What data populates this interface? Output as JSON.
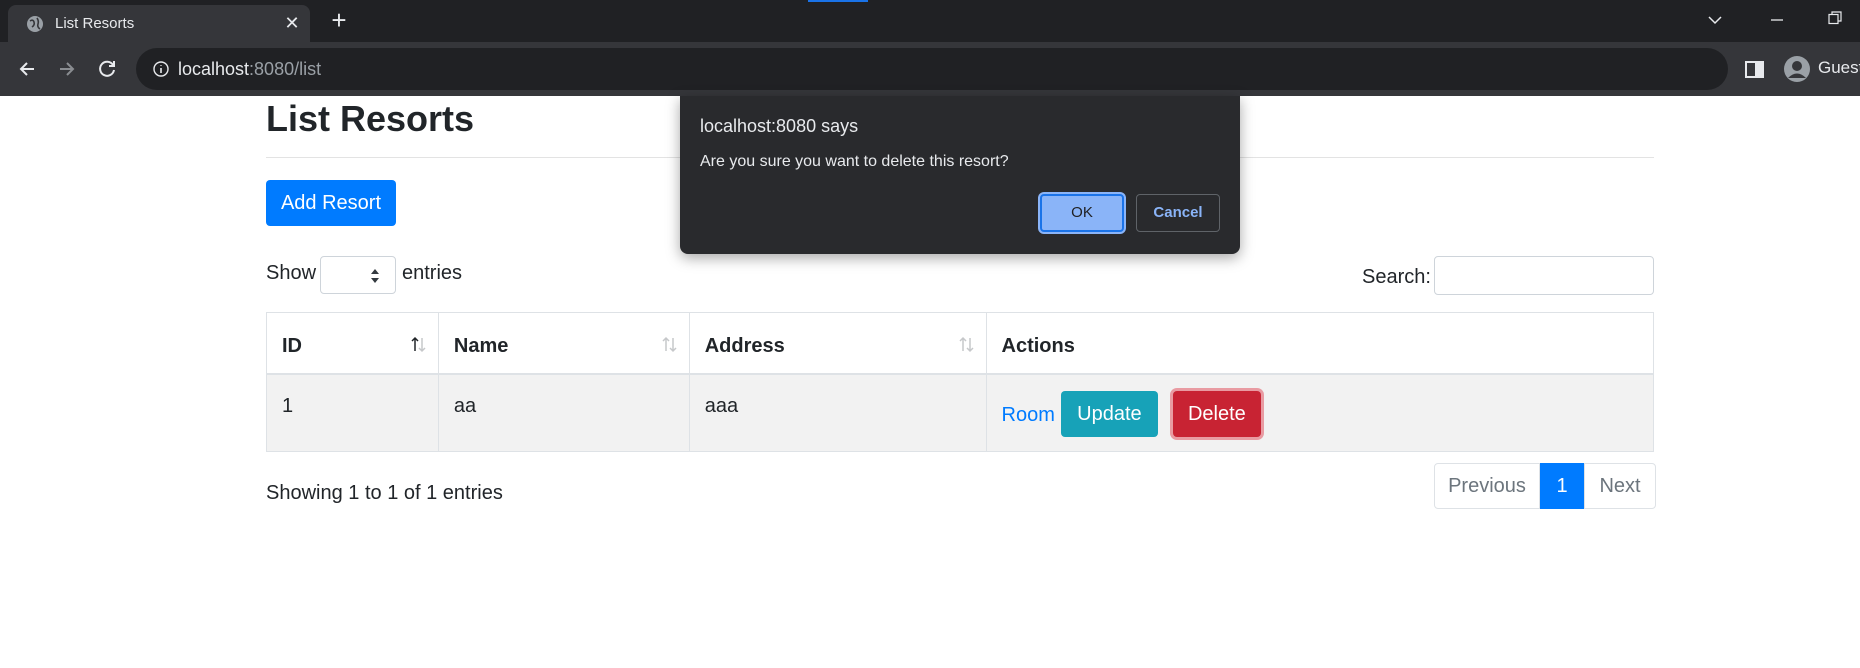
{
  "browser": {
    "tab_title": "List Resorts",
    "url_host": "localhost",
    "url_rest": ":8080/list",
    "profile_label": "Guest",
    "icons": [
      "globe-icon",
      "close-icon",
      "plus-icon",
      "chevron-down-icon",
      "minimize-icon",
      "restore-icon",
      "back-icon",
      "forward-icon",
      "reload-icon",
      "info-icon",
      "side-panel-icon",
      "profile-icon"
    ]
  },
  "page": {
    "title": "List Resorts",
    "add_button": "Add Resort",
    "show_label": "Show",
    "entries_label": "entries",
    "search_label": "Search:",
    "search_value": "",
    "entries_select_value": ""
  },
  "table": {
    "columns": [
      "ID",
      "Name",
      "Address",
      "Actions"
    ],
    "rows": [
      {
        "id": "1",
        "name": "aa",
        "address": "aaa",
        "room_link": "Room",
        "update": "Update",
        "delete": "Delete"
      }
    ]
  },
  "footer": {
    "info": "Showing 1 to 1 of 1 entries",
    "previous": "Previous",
    "current_page": "1",
    "next": "Next"
  },
  "dialog": {
    "title": "localhost:8080 says",
    "message": "Are you sure you want to delete this resort?",
    "ok": "OK",
    "cancel": "Cancel"
  },
  "colors": {
    "primary": "#007bff",
    "info": "#17a2b8",
    "danger": "#c82333",
    "chrome_dark": "#202124",
    "dialog_bg": "#292a2d",
    "dialog_accent": "#8ab4f8"
  }
}
